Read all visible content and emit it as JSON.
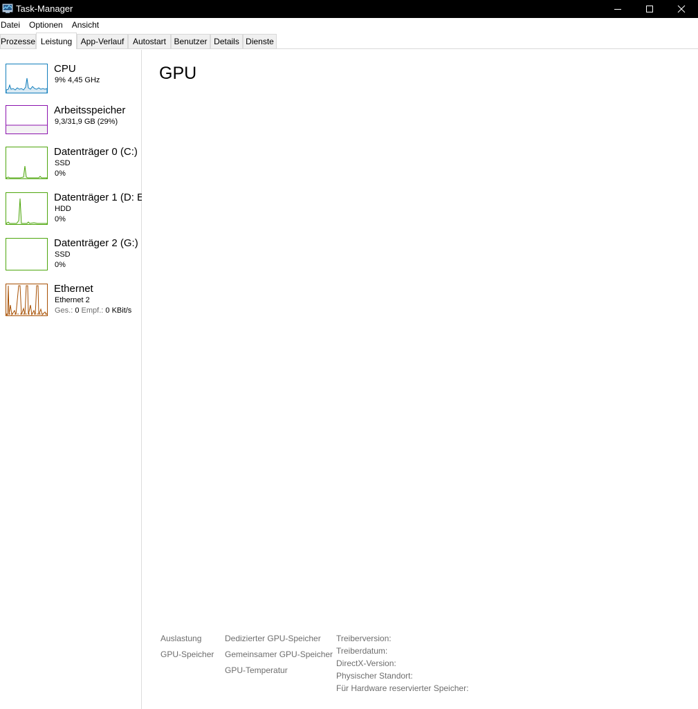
{
  "window": {
    "title": "Task-Manager",
    "icon": "task-manager-icon",
    "controls": [
      "minimize-icon",
      "maximize-icon",
      "close-icon"
    ]
  },
  "menu": {
    "file": "Datei",
    "options": "Optionen",
    "view": "Ansicht"
  },
  "tabs": [
    {
      "label": "Prozesse",
      "active": false
    },
    {
      "label": "Leistung",
      "active": true
    },
    {
      "label": "App-Verlauf",
      "active": false
    },
    {
      "label": "Autostart",
      "active": false
    },
    {
      "label": "Benutzer",
      "active": false
    },
    {
      "label": "Details",
      "active": false
    },
    {
      "label": "Dienste",
      "active": false
    }
  ],
  "sidebar": {
    "items": [
      {
        "title": "CPU",
        "line1": "9%  4,45 GHz",
        "line2": "",
        "color": "#117dbb"
      },
      {
        "title": "Arbeitsspeicher",
        "line1": "9,3/31,9 GB (29%)",
        "line2": "",
        "color": "#8b12ae",
        "fill_fraction": 0.29
      },
      {
        "title": "Datenträger 0 (C:)",
        "line1": "SSD",
        "line2": "0%",
        "color": "#4da60c"
      },
      {
        "title": "Datenträger 1 (D: E",
        "line1": "HDD",
        "line2": "0%",
        "color": "#4da60c"
      },
      {
        "title": "Datenträger 2 (G:)",
        "line1": "SSD",
        "line2": "0%",
        "color": "#4da60c"
      },
      {
        "title": "Ethernet",
        "line1": "Ethernet 2",
        "color": "#a74f01",
        "send_label": "Ges.:",
        "send_value": "0",
        "recv_label": "Empf.:",
        "recv_value": "0 KBit/s"
      }
    ]
  },
  "main": {
    "title": "GPU",
    "stats_col1": [
      "Auslastung",
      "GPU-Speicher"
    ],
    "stats_col2": [
      "Dedizierter GPU-Speicher",
      "Gemeinsamer GPU-Speicher",
      "GPU-Temperatur"
    ],
    "stats_col3": [
      "Treiberversion:",
      "Treiberdatum:",
      "DirectX-Version:",
      "Physischer Standort:",
      "Für Hardware reservierter Speicher:"
    ]
  }
}
